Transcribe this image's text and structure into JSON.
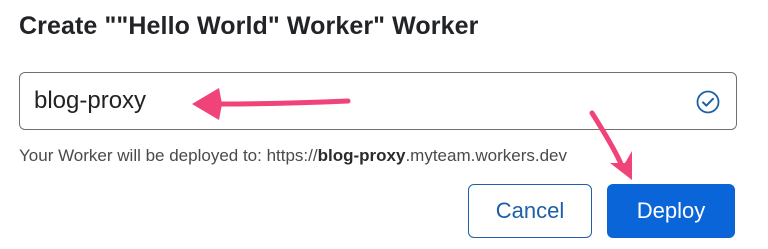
{
  "dialog": {
    "title": "Create \"\"Hello World\" Worker\" Worker"
  },
  "name_input": {
    "value": "blog-proxy",
    "status_icon": "check-circle-icon"
  },
  "helper": {
    "prefix": "Your Worker will be deployed to: https://",
    "subdomain": "blog-proxy",
    "suffix": ".myteam.workers.dev"
  },
  "actions": {
    "cancel_label": "Cancel",
    "deploy_label": "Deploy"
  },
  "colors": {
    "primary": "#0a66d8",
    "secondary_border": "#1d5fa8",
    "annotation_arrow": "#f0437a",
    "check_icon": "#1d5fa8"
  }
}
